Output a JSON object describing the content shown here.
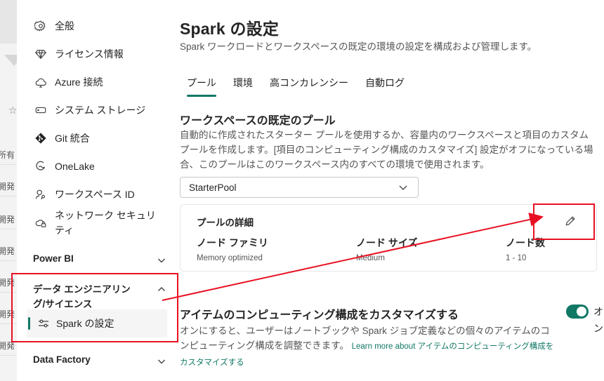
{
  "background": {
    "rows": [
      "所有",
      "開発",
      "開発",
      "開発",
      "開発",
      "開発",
      "開発"
    ]
  },
  "sidebar": {
    "items": [
      {
        "label": "全般",
        "icon": "gear-icon"
      },
      {
        "label": "ライセンス情報",
        "icon": "diamond-icon"
      },
      {
        "label": "Azure 接続",
        "icon": "cloud-icon"
      },
      {
        "label": "システム ストレージ",
        "icon": "storage-icon"
      },
      {
        "label": "Git 統合",
        "icon": "git-icon"
      },
      {
        "label": "OneLake",
        "icon": "onelake-icon"
      },
      {
        "label": "ワークスペース ID",
        "icon": "identity-icon"
      },
      {
        "label_line1": "ネットワーク セキュリ",
        "label_line2": "ティ",
        "icon": "cloud-lock-icon"
      }
    ],
    "sections": [
      {
        "label": "Power BI",
        "expanded": false
      },
      {
        "label_line1": "データ エンジニアリン",
        "label_line2": "グ/サイエンス",
        "expanded": true
      },
      {
        "label": "Data Factory",
        "expanded": false
      }
    ],
    "selected_sub_item": {
      "label": "Spark の設定",
      "icon": "settings-sliders-icon"
    }
  },
  "main": {
    "title": "Spark の設定",
    "subtitle": "Spark ワークロードとワークスペースの既定の環境の設定を構成および管理します。",
    "tabs": [
      {
        "label": "プール",
        "active": true
      },
      {
        "label": "環境",
        "active": false
      },
      {
        "label": "高コンカレンシー",
        "active": false
      },
      {
        "label": "自動ログ",
        "active": false
      }
    ],
    "pool_section": {
      "title": "ワークスペースの既定のプール",
      "description": "自動的に作成されたスターター プールを使用するか、容量内のワークスペースと項目のカスタム プールを作成します。[項目のコンピューティング構成のカスタマイズ] 設定がオフになっている場合、このプールはこのワークスペース内のすべての環境で使用されます。",
      "selected_pool": "StarterPool"
    },
    "pool_details": {
      "title": "プールの詳細",
      "node_family_label": "ノード ファミリ",
      "node_family_value": "Memory optimized",
      "node_size_label": "ノード サイズ",
      "node_size_value": "Medium",
      "node_count_label": "ノード数",
      "node_count_value": "1 - 10"
    },
    "customize": {
      "title": "アイテムのコンピューティング構成をカスタマイズする",
      "toggle_state": "オン",
      "toggle_on": true,
      "description": "オンにすると、ユーザーはノートブックや Spark ジョブ定義などの個々のアイテムのコンピューティング構成を調整できます。",
      "link": "Learn more about アイテムのコンピューティング構成をカスタマイズする"
    }
  },
  "colors": {
    "accent": "#117865",
    "annotation": "#e81123"
  }
}
